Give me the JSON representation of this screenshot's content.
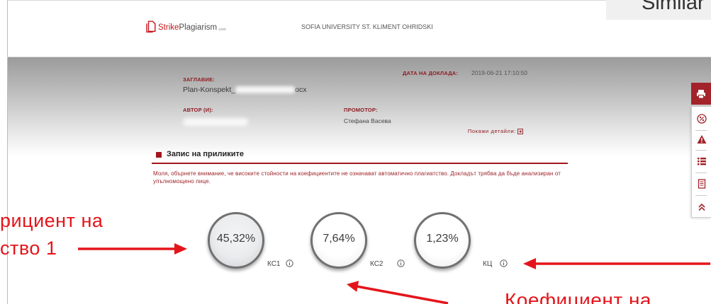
{
  "corner_tab": {
    "label": "Similar"
  },
  "header": {
    "logo": {
      "strike": "Strike",
      "plagiarism": "Plagiarism",
      "com": ".com",
      "icon": "strikeplagiarism-logo-icon"
    },
    "university": "SOFIA UNIVERSITY ST. KLIMENT OHRIDSKI"
  },
  "report": {
    "title_label": "ЗАГЛАВИЕ:",
    "title_value_prefix": "Plan-Konspekt_",
    "title_value_suffix": "ocx",
    "date_label": "ДАТА НА ДОКЛАДА:",
    "date_value": "2019-06-21 17:10:50",
    "author_label": "АВТОР (И):",
    "promoter_label": "ПРОМОТОР:",
    "promoter_value": "Стефана Васева",
    "details_link": "Покажи детайли:",
    "details_icon": "expand-box-icon"
  },
  "similarity_section": {
    "heading": "Запис на приликите",
    "notice_lines": [
      "Моля, обърнете внимание, че високите стойности на коефициентите не означават автоматично плагиатство. Докладът трябва да бъде анализиран от",
      "упълномощено лице."
    ]
  },
  "coefficients": [
    {
      "value": "45,32%",
      "label": "КС1",
      "icon": "info-icon"
    },
    {
      "value": "7,64%",
      "label": "КС2",
      "icon": "info-icon"
    },
    {
      "value": "1,23%",
      "label": "КЦ",
      "icon": "info-icon"
    }
  ],
  "sidebar_toolbar": {
    "buttons": [
      {
        "icon": "printer-icon"
      },
      {
        "icon": "percent-icon"
      },
      {
        "icon": "warning-icon"
      },
      {
        "icon": "list-icon"
      },
      {
        "icon": "document-icon"
      },
      {
        "icon": "double-chevron-up-icon"
      }
    ]
  },
  "annotations": {
    "left_text_lines": [
      "рициент на",
      "ство 1"
    ],
    "bottom_right_text": "Коефициент на"
  },
  "colors": {
    "brand_red": "#c4161c",
    "accent_dark_red": "#a3161d",
    "toolbar_red": "#a3232a",
    "annotation_red": "#e3151b",
    "circle_border": "#707070"
  }
}
